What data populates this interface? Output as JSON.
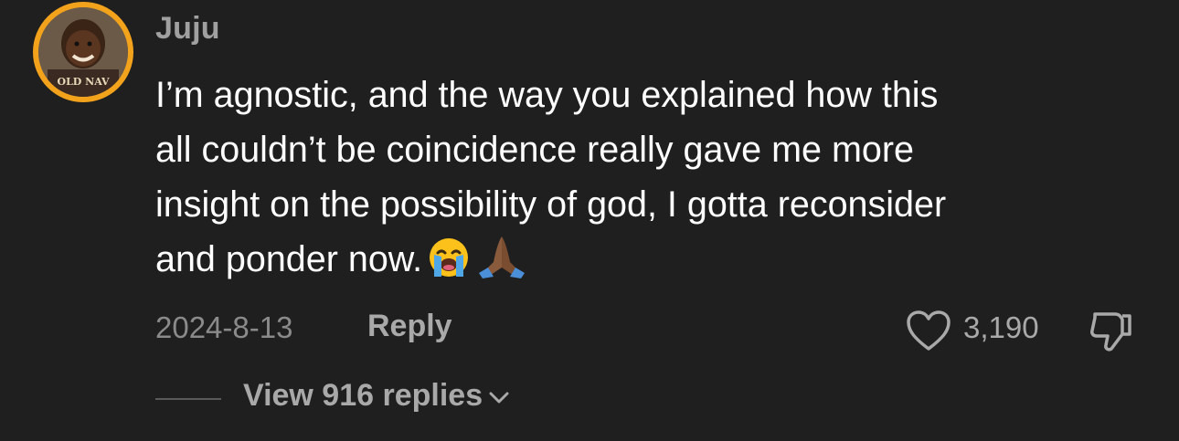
{
  "comment": {
    "username": "Juju",
    "lines": [
      "I’m agnostic, and the way you explained how this",
      "all couldn’t be coincidence really gave me more",
      "insight on the possibility of god, I gotta reconsider",
      "and ponder now."
    ],
    "emojis": [
      "loudly-crying-face-emoji",
      "folded-hands-emoji"
    ],
    "date": "2024-8-13",
    "reply_label": "Reply",
    "like_count": "3,190",
    "view_replies_label": "View 916 replies"
  },
  "colors": {
    "background": "#1f1f1f",
    "primary_text": "#ffffff",
    "secondary_text": "#a9a9a9",
    "avatar_ring": "#f3a21b"
  }
}
